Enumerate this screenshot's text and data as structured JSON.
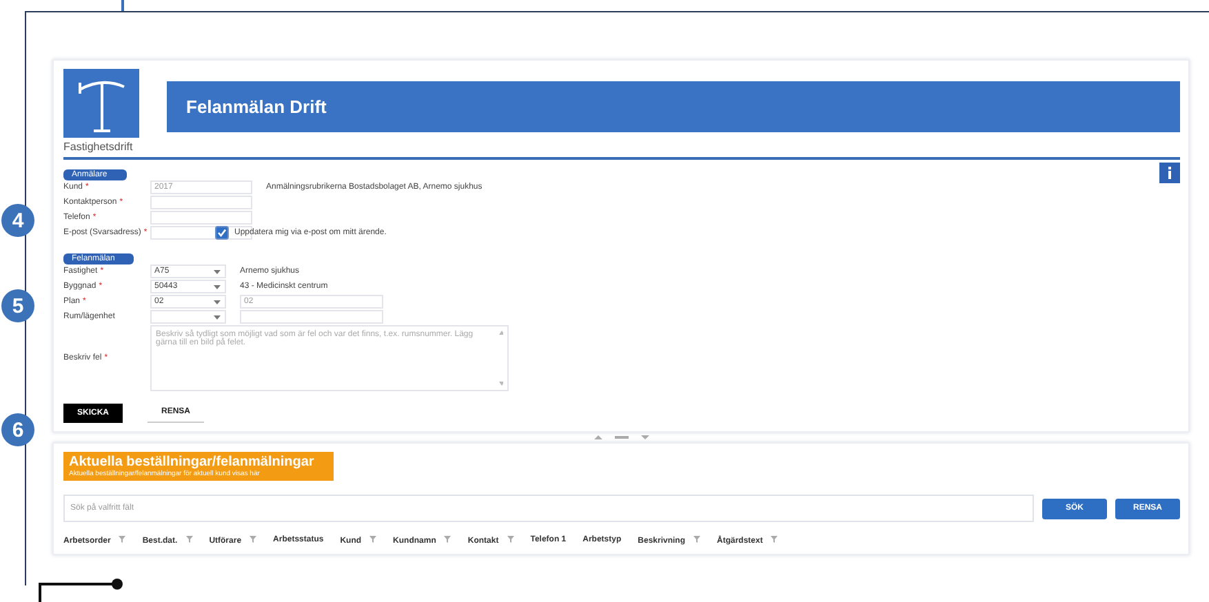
{
  "callouts": [
    {
      "label": "4"
    },
    {
      "label": "5"
    },
    {
      "label": "6"
    }
  ],
  "header": {
    "logo_caption": "Fastighetsdrift",
    "title": "Felanmälan Drift"
  },
  "reporter": {
    "heading": "Anmälare",
    "fields": [
      {
        "kind": "text",
        "label": "Kund",
        "required_mark": "*",
        "placeholder": "2017",
        "note": "Anmälningsrubrikerna Bostadsbolaget AB, Arnemo sjukhus"
      },
      {
        "kind": "text",
        "label": "Kontaktperson",
        "required_mark": "*"
      },
      {
        "kind": "text",
        "label": "Telefon",
        "required_mark": "*"
      },
      {
        "kind": "text",
        "label": "E-post (Svarsadress)",
        "required_mark": "*"
      }
    ],
    "checkbox": {
      "label": "Uppdatera mig via e-post om mitt ärende.",
      "checked": true
    }
  },
  "report": {
    "heading": "Felanmälan",
    "fields": [
      {
        "kind": "select",
        "label": "Fastighet",
        "required_mark": "*",
        "value": "A75",
        "note": "Arnemo sjukhus"
      },
      {
        "kind": "select",
        "label": "Byggnad",
        "required_mark": "*",
        "value": "50443",
        "note": "43 - Medicinskt centrum"
      },
      {
        "kind": "select_text",
        "label": "Plan",
        "required_mark": "*",
        "value": "02",
        "text_value": "02"
      },
      {
        "kind": "select_text",
        "label": "Rum/lägenhet"
      },
      {
        "kind": "textarea",
        "label": "Beskriv fel",
        "required_mark": "*",
        "placeholder": "Beskriv så tydligt som möjligt vad som är fel och var det finns, t.ex. rumsnummer. Lägg gärna till en bild på felet."
      }
    ]
  },
  "actions": [
    "SKICKA",
    "RENSA"
  ],
  "orders": {
    "title": "Aktuella beställningar/felanmälningar",
    "subtitle": "Aktuella beställningar/felanmälningar för aktuell kund visas här",
    "search_placeholder": "Sök på valfritt fält",
    "buttons": [
      "SÖK",
      "RENSA"
    ],
    "columns": [
      {
        "label": "Arbetsorder",
        "filter": true
      },
      {
        "label": "Best.dat.",
        "filter": true
      },
      {
        "label": "Utförare",
        "filter": true
      },
      {
        "label": "Arbetsstatus",
        "filter": false
      },
      {
        "label": "Kund",
        "filter": true
      },
      {
        "label": "Kundnamn",
        "filter": true
      },
      {
        "label": "Kontakt",
        "filter": true
      },
      {
        "label": "Telefon 1",
        "filter": false
      },
      {
        "label": "Arbetstyp",
        "filter": false
      },
      {
        "label": "Beskrivning",
        "filter": true
      },
      {
        "label": "Åtgärdstext",
        "filter": true
      }
    ]
  }
}
